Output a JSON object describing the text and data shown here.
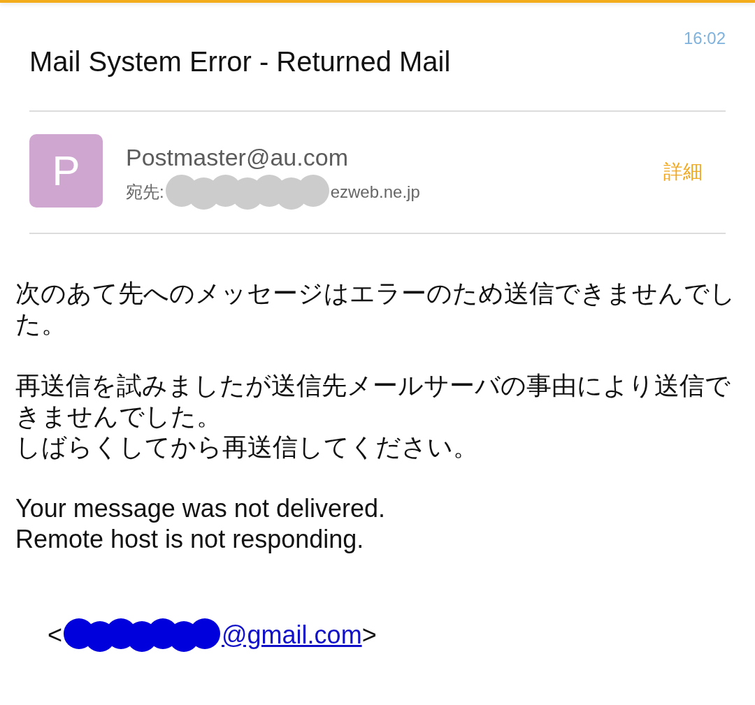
{
  "header": {
    "subject": "Mail System Error - Returned Mail",
    "time": "16:02"
  },
  "sender": {
    "avatar_letter": "P",
    "name": "Postmaster@au.com",
    "to_label": "宛先:",
    "to_redacted": true,
    "to_visible": "ezweb.ne.jp",
    "details": "詳細"
  },
  "body": {
    "paragraphs": [
      {
        "lines": [
          "次のあて先へのメッセージはエラーのため送信できませんでした。"
        ]
      },
      {
        "lines": [
          "再送信を試みましたが送信先メールサーバの事由により送信できませんでした。",
          "しばらくしてから再送信してください。"
        ]
      },
      {
        "lines": [
          "Your message was not delivered.",
          "Remote host is not responding."
        ]
      }
    ],
    "recipient": {
      "open": "<",
      "redacted": true,
      "link": "@gmail.com",
      "close": ">"
    }
  }
}
